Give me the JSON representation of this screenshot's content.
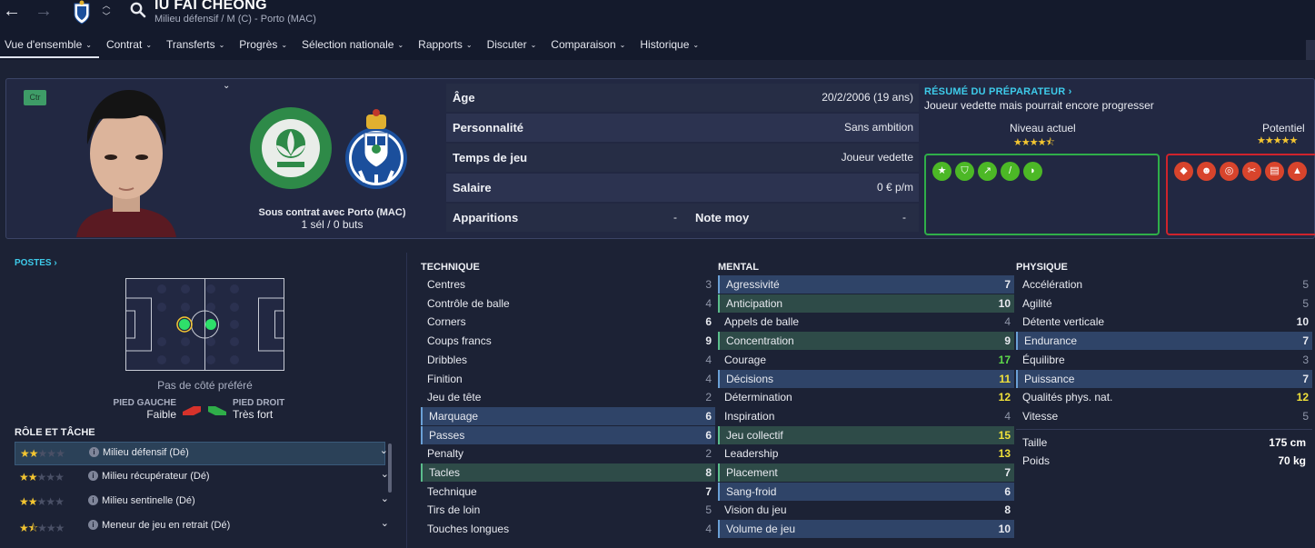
{
  "header": {
    "player_name": "IU FAI CHEONG",
    "subtitle": "Milieu défensif / M (C) - Porto (MAC)"
  },
  "tabs": [
    {
      "label": "Vue d'ensemble",
      "active": true
    },
    {
      "label": "Contrat"
    },
    {
      "label": "Transferts"
    },
    {
      "label": "Progrès"
    },
    {
      "label": "Sélection nationale"
    },
    {
      "label": "Rapports"
    },
    {
      "label": "Discuter"
    },
    {
      "label": "Comparaison"
    },
    {
      "label": "Historique"
    }
  ],
  "profile": {
    "badge": "Ctr",
    "contract": "Sous contrat avec Porto (MAC)",
    "caps": "1 sél / 0 buts",
    "info": [
      {
        "label": "Âge",
        "value": "20/2/2006 (19 ans)"
      },
      {
        "label": "Personnalité",
        "value": "Sans ambition"
      },
      {
        "label": "Temps de jeu",
        "value": "Joueur vedette"
      },
      {
        "label": "Salaire",
        "value": "0 € p/m"
      }
    ],
    "appearances_label": "Apparitions",
    "appearances_value": "-",
    "avg_rating_label": "Note moy",
    "avg_rating_value": "-"
  },
  "scout": {
    "title": "RÉSUMÉ DU PRÉPARATEUR ›",
    "text": "Joueur vedette mais pourrait encore progresser",
    "current_label": "Niveau actuel",
    "current_stars": 4.5,
    "potential_label": "Potentiel",
    "potential_stars": 5,
    "positive_traits": [
      "star-icon",
      "shield-icon",
      "trend-icon",
      "leg-icon",
      "boots-icon"
    ],
    "negative_traits": [
      "cards-icon",
      "head-icon",
      "target-icon",
      "tackle-icon",
      "document-icon",
      "fire-icon"
    ]
  },
  "positions": {
    "title": "POSTES ›",
    "preferred_side": "Pas de côté préféré",
    "left_foot_label": "PIED GAUCHE",
    "left_foot_value": "Faible",
    "right_foot_label": "PIED DROIT",
    "right_foot_value": "Très fort"
  },
  "roles": {
    "title": "RÔLE ET TÂCHE",
    "items": [
      {
        "stars": 2,
        "name": "Milieu défensif (Dé)",
        "selected": true
      },
      {
        "stars": 2,
        "name": "Milieu récupérateur (Dé)"
      },
      {
        "stars": 2,
        "name": "Milieu sentinelle (Dé)"
      },
      {
        "stars": 1.5,
        "name": "Meneur de jeu en retrait (Dé)"
      }
    ]
  },
  "attributes": {
    "technique_title": "TECHNIQUE",
    "mental_title": "MENTAL",
    "physique_title": "PHYSIQUE",
    "technique": [
      {
        "name": "Centres",
        "value": 3
      },
      {
        "name": "Contrôle de balle",
        "value": 4
      },
      {
        "name": "Corners",
        "value": 6
      },
      {
        "name": "Coups francs",
        "value": 9
      },
      {
        "name": "Dribbles",
        "value": 4
      },
      {
        "name": "Finition",
        "value": 4
      },
      {
        "name": "Jeu de tête",
        "value": 2
      },
      {
        "name": "Marquage",
        "value": 6,
        "hl": "blue"
      },
      {
        "name": "Passes",
        "value": 6,
        "hl": "blue"
      },
      {
        "name": "Penalty",
        "value": 2
      },
      {
        "name": "Tacles",
        "value": 8,
        "hl": "green"
      },
      {
        "name": "Technique",
        "value": 7
      },
      {
        "name": "Tirs de loin",
        "value": 5
      },
      {
        "name": "Touches longues",
        "value": 4
      }
    ],
    "mental": [
      {
        "name": "Agressivité",
        "value": 7,
        "hl": "blue"
      },
      {
        "name": "Anticipation",
        "value": 10,
        "hl": "green"
      },
      {
        "name": "Appels de balle",
        "value": 4
      },
      {
        "name": "Concentration",
        "value": 9,
        "hl": "green"
      },
      {
        "name": "Courage",
        "value": 17
      },
      {
        "name": "Décisions",
        "value": 11,
        "hl": "blue"
      },
      {
        "name": "Détermination",
        "value": 12
      },
      {
        "name": "Inspiration",
        "value": 4
      },
      {
        "name": "Jeu collectif",
        "value": 15,
        "hl": "green"
      },
      {
        "name": "Leadership",
        "value": 13
      },
      {
        "name": "Placement",
        "value": 7,
        "hl": "green"
      },
      {
        "name": "Sang-froid",
        "value": 6,
        "hl": "blue"
      },
      {
        "name": "Vision du jeu",
        "value": 8
      },
      {
        "name": "Volume de jeu",
        "value": 10,
        "hl": "blue"
      }
    ],
    "physique": [
      {
        "name": "Accélération",
        "value": 5
      },
      {
        "name": "Agilité",
        "value": 5
      },
      {
        "name": "Détente verticale",
        "value": 10
      },
      {
        "name": "Endurance",
        "value": 7,
        "hl": "blue"
      },
      {
        "name": "Équilibre",
        "value": 3
      },
      {
        "name": "Puissance",
        "value": 7,
        "hl": "blue"
      },
      {
        "name": "Qualités phys. nat.",
        "value": 12
      },
      {
        "name": "Vitesse",
        "value": 5
      }
    ],
    "height_label": "Taille",
    "height_value": "175 cm",
    "weight_label": "Poids",
    "weight_value": "70 kg"
  }
}
